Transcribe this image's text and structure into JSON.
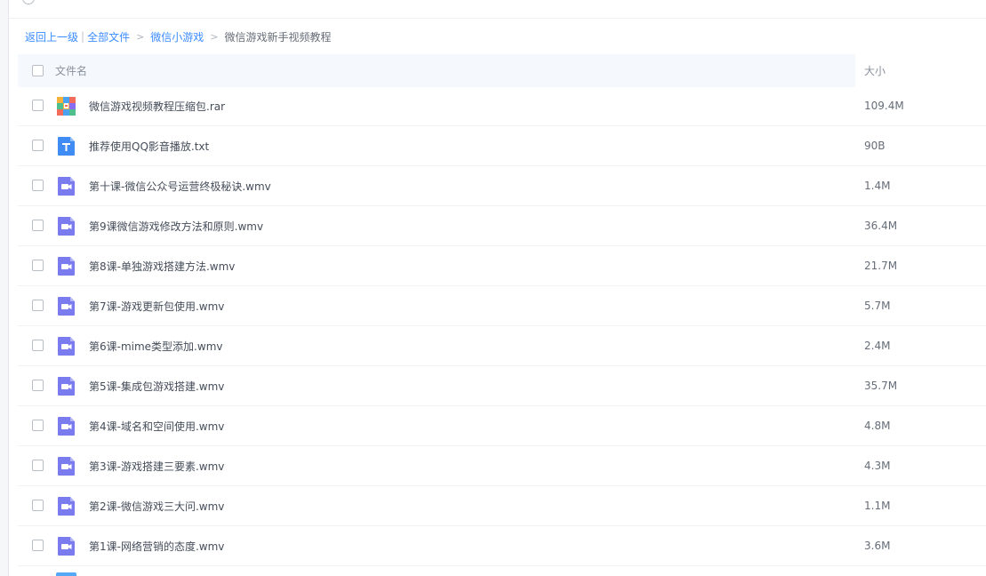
{
  "breadcrumb": {
    "back": "返回上一级",
    "separator": "|",
    "items": [
      "全部文件",
      "微信小游戏"
    ],
    "current": "微信游戏新手视频教程"
  },
  "table": {
    "headers": {
      "name": "文件名",
      "size": "大小"
    },
    "rows": [
      {
        "icon": "archive-icon",
        "name": "微信游戏视频教程压缩包.rar",
        "size": "109.4M"
      },
      {
        "icon": "text-file-icon",
        "name": "推荐使用QQ影音播放.txt",
        "size": "90B"
      },
      {
        "icon": "video-file-icon",
        "name": "第十课-微信公众号运营终极秘诀.wmv",
        "size": "1.4M"
      },
      {
        "icon": "video-file-icon",
        "name": "第9课微信游戏修改方法和原则.wmv",
        "size": "36.4M"
      },
      {
        "icon": "video-file-icon",
        "name": "第8课-单独游戏搭建方法.wmv",
        "size": "21.7M"
      },
      {
        "icon": "video-file-icon",
        "name": "第7课-游戏更新包使用.wmv",
        "size": "5.7M"
      },
      {
        "icon": "video-file-icon",
        "name": "第6课-mime类型添加.wmv",
        "size": "2.4M"
      },
      {
        "icon": "video-file-icon",
        "name": "第5课-集成包游戏搭建.wmv",
        "size": "35.7M"
      },
      {
        "icon": "video-file-icon",
        "name": "第4课-域名和空间使用.wmv",
        "size": "4.8M"
      },
      {
        "icon": "video-file-icon",
        "name": "第3课-游戏搭建三要素.wmv",
        "size": "4.3M"
      },
      {
        "icon": "video-file-icon",
        "name": "第2课-微信游戏三大问.wmv",
        "size": "1.1M"
      },
      {
        "icon": "video-file-icon",
        "name": "第1课-网络营销的态度.wmv",
        "size": "3.6M"
      }
    ]
  },
  "colors": {
    "link": "#3b8cff",
    "header_bg": "#f5f8fd",
    "video_icon": "#7b7bf0",
    "text_icon": "#3f8cf5"
  }
}
